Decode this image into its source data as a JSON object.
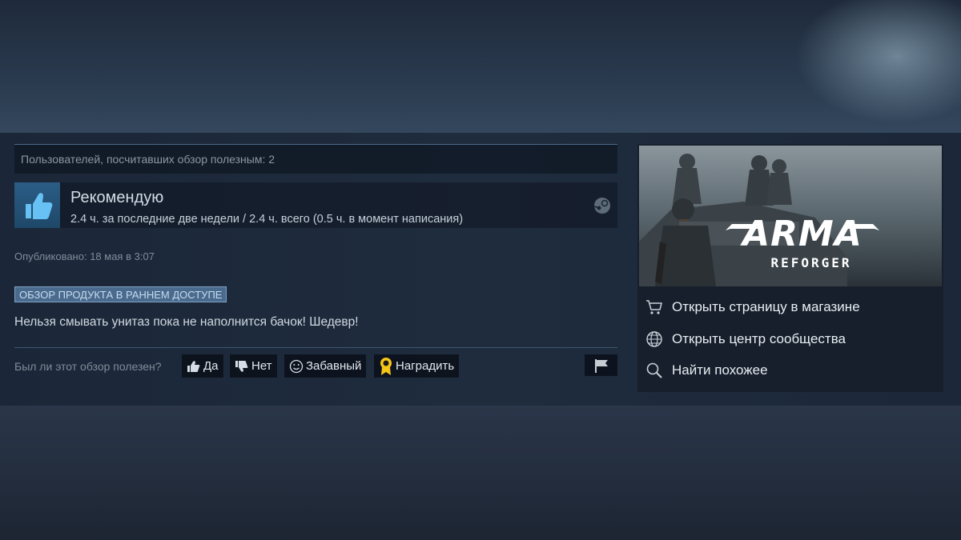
{
  "review": {
    "helpful_count_text": "Пользователей, посчитавших обзор полезным: 2",
    "recommendation": "Рекомендую",
    "hours": "2.4 ч. за последние две недели / 2.4 ч. всего (0.5 ч. в момент написания)",
    "posted": "Опубликовано: 18 мая в 3:07",
    "early_access_tag": "ОБЗОР ПРОДУКТА В РАННЕМ ДОСТУПЕ",
    "text": "Нельзя смывать унитаз пока не наполнится бачок! Шедевр!",
    "helpful_question": "Был ли этот обзор полезен?",
    "vote_yes": "Да",
    "vote_no": "Нет",
    "vote_funny": "Забавный",
    "award": "Наградить"
  },
  "game": {
    "logo_title": "ARMA",
    "logo_subtitle": "REFORGER"
  },
  "side_links": [
    {
      "label": "Открыть страницу в магазине",
      "icon": "cart-icon"
    },
    {
      "label": "Открыть центр сообщества",
      "icon": "globe-icon"
    },
    {
      "label": "Найти похожее",
      "icon": "search-icon"
    }
  ],
  "colors": {
    "accent": "#4b6b8e",
    "award": "#f5c518"
  }
}
